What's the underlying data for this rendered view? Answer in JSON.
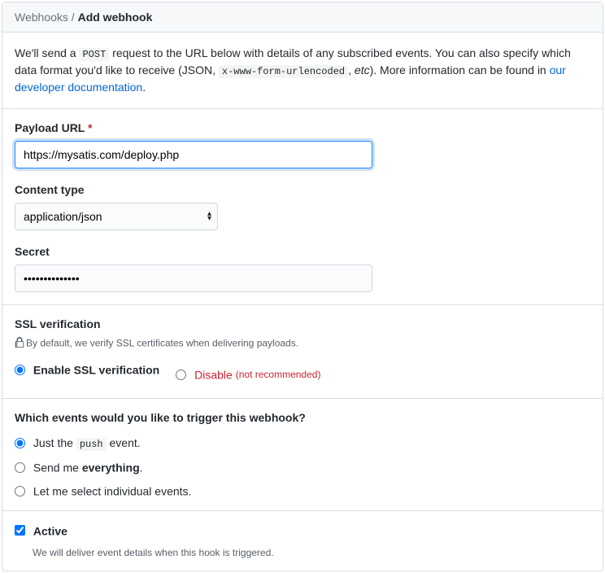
{
  "breadcrumb": {
    "parent": "Webhooks",
    "separator": "/",
    "current": "Add webhook"
  },
  "intro": {
    "part1": "We'll send a ",
    "post_code": "POST",
    "part2": " request to the URL below with details of any subscribed events. You can also specify which data format you'd like to receive (JSON, ",
    "form_code": "x-www-form-urlencoded",
    "part3": ", ",
    "etc": "etc",
    "part4": "). More information can be found in ",
    "link_text": "our developer documentation",
    "part5": "."
  },
  "payload_url": {
    "label": "Payload URL",
    "value": "https://mysatis.com/deploy.php"
  },
  "content_type": {
    "label": "Content type",
    "selected": "application/json"
  },
  "secret": {
    "label": "Secret",
    "value": "••••••••••••••"
  },
  "ssl": {
    "heading": "SSL verification",
    "note": "By default, we verify SSL certificates when delivering payloads.",
    "enable_label": "Enable SSL verification",
    "disable_label": "Disable",
    "disable_note": "(not recommended)"
  },
  "events": {
    "question": "Which events would you like to trigger this webhook?",
    "just_push_prefix": "Just the ",
    "push_word": "push",
    "just_push_suffix": " event.",
    "everything_prefix": "Send me ",
    "everything_bold": "everything",
    "everything_suffix": ".",
    "individual": "Let me select individual events."
  },
  "active": {
    "label": "Active",
    "description": "We will deliver event details when this hook is triggered."
  }
}
